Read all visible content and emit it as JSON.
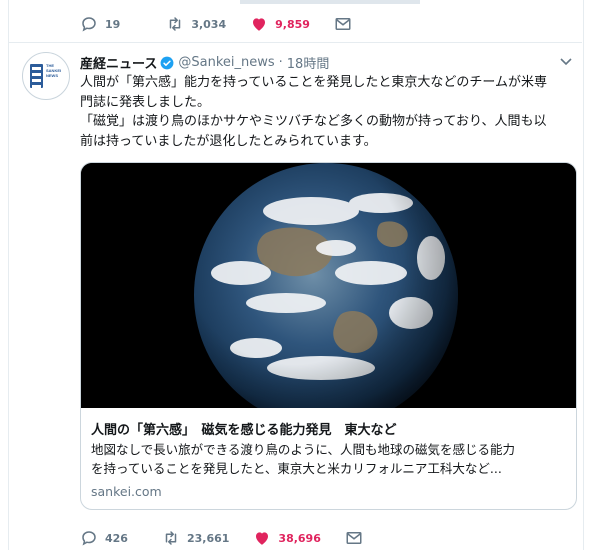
{
  "previous_tweet": {
    "actions": {
      "replies": "19",
      "retweets": "3,034",
      "likes": "9,859"
    }
  },
  "tweet": {
    "author": {
      "name": "産経ニュース",
      "handle": "@Sankei_news",
      "separator": "·",
      "time": "18時間",
      "avatar_label": "THE SANKEI NEWS"
    },
    "text_lines": [
      "人間が「第六感」能力を持っていることを発見したと東京大などのチームが米専",
      "門誌に発表しました。",
      "「磁覚」は渡り鳥のほかサケやミツバチなど多くの動物が持っており、人間も以",
      "前は持っていましたが退化したとみられています。"
    ],
    "card": {
      "title": "人間の「第六感」　磁気を感じる能力発見　東大など",
      "description_lines": [
        "地図なしで長い旅ができる渡り鳥のように、人間も地球の磁気を感じる能力",
        "を持っていることを発見したと、東京大と米カリフォルニア工科大など..."
      ],
      "domain": "sankei.com"
    },
    "actions": {
      "replies": "426",
      "retweets": "23,661",
      "likes": "38,696"
    }
  },
  "icons": [
    "reply-icon",
    "retweet-icon",
    "heart-icon",
    "dm-icon",
    "verified-badge-icon",
    "caret-down-icon"
  ],
  "colors": {
    "like_red": "#e0245e",
    "verified_blue": "#1da1f2",
    "muted_text": "#657786",
    "border": "#e6ecf0"
  }
}
